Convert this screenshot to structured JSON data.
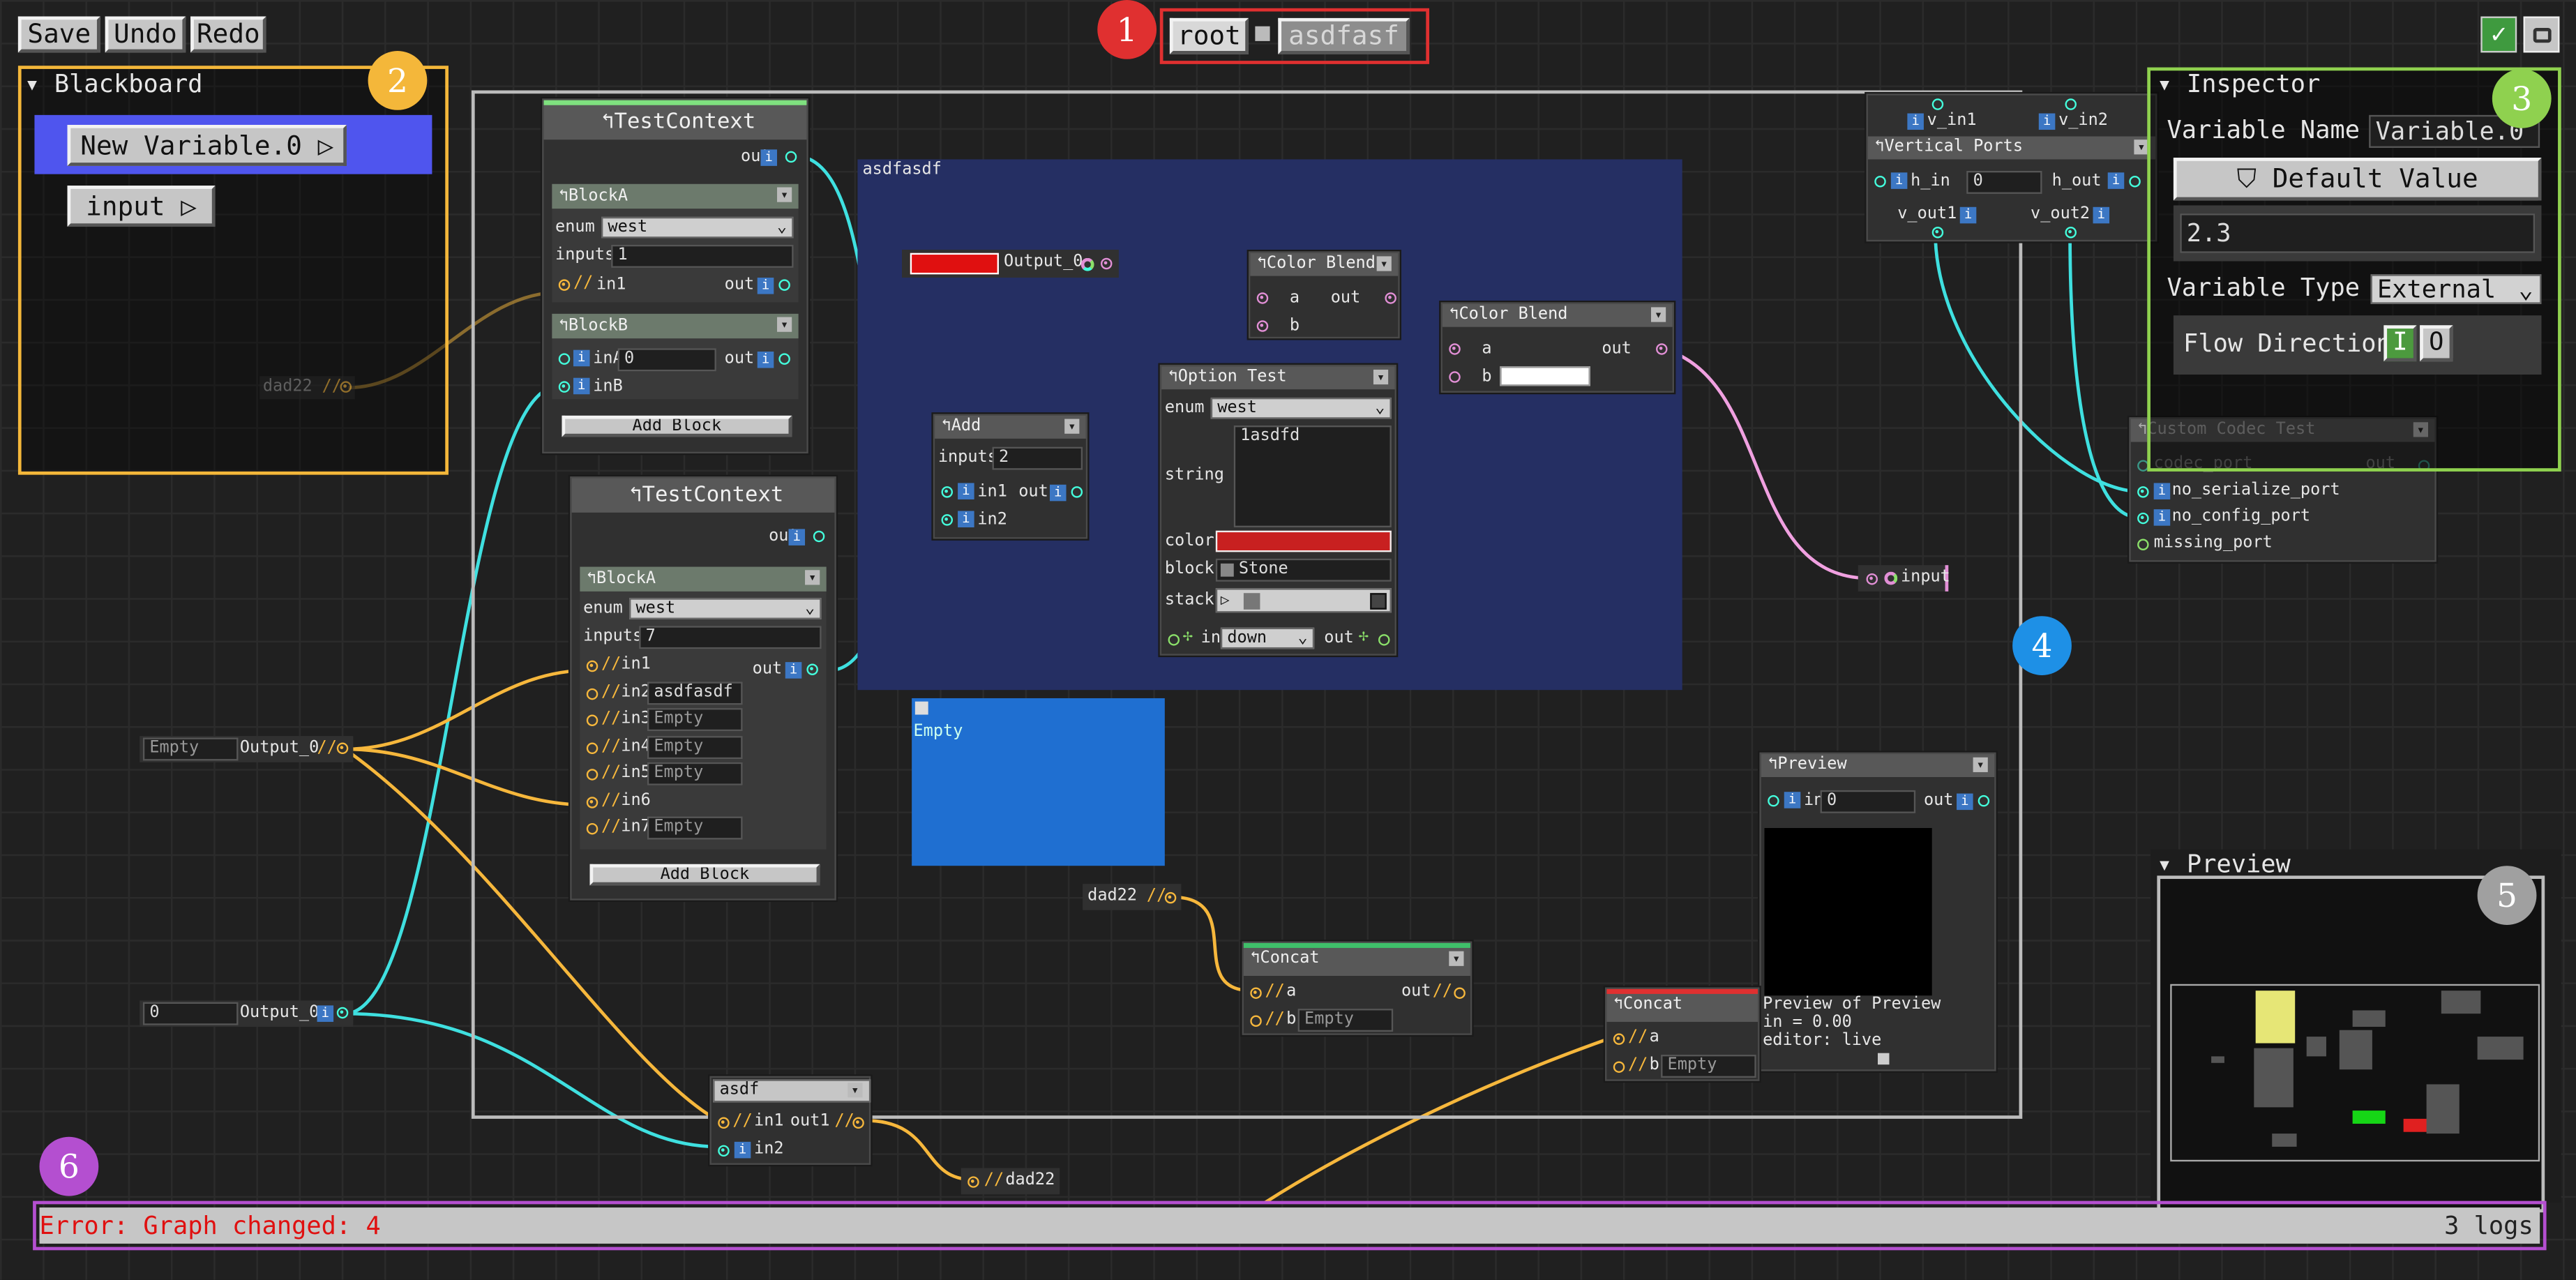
{
  "toolbar": {
    "save": "Save",
    "undo": "Undo",
    "redo": "Redo"
  },
  "breadcrumb": {
    "root": "root",
    "current": "asdfasf"
  },
  "badges": [
    "1",
    "2",
    "3",
    "4",
    "5",
    "6"
  ],
  "blackboard": {
    "title": "Blackboard",
    "items": [
      "New Variable.0",
      "input"
    ]
  },
  "inspector": {
    "title": "Inspector",
    "var_name_label": "Variable Name",
    "var_name_value": "Variable.0",
    "default_value_label": "Default Value",
    "default_value": "2.3",
    "var_type_label": "Variable Type",
    "var_type_value": "External",
    "flow_label": "Flow Direction",
    "flow_in": "I",
    "flow_out": "O"
  },
  "preview_panel": {
    "title": "Preview"
  },
  "status": {
    "error": "Error: Graph changed: 4",
    "logs": "3 logs"
  },
  "group": {
    "title": "asdfasdf"
  },
  "empty_note": "Empty",
  "nodes": {
    "tc1": {
      "title": "TestContext",
      "out": "out",
      "blockA": {
        "title": "BlockA",
        "enum_label": "enum",
        "enum_value": "west",
        "inputs_label": "inputs",
        "inputs_value": "1",
        "in1": "in1",
        "out": "out"
      },
      "blockB": {
        "title": "BlockB",
        "inA": "inA",
        "inA_value": "0",
        "inB": "inB",
        "out": "out"
      },
      "add_block": "Add Block"
    },
    "tc2": {
      "title": "TestContext",
      "out": "out",
      "blockA": {
        "title": "BlockA",
        "enum_label": "enum",
        "enum_value": "west",
        "inputs_label": "inputs",
        "inputs_value": "7",
        "out": "out",
        "ins": [
          {
            "label": "in1",
            "value": ""
          },
          {
            "label": "in2",
            "value": "asdfasdf"
          },
          {
            "label": "in3",
            "value": "Empty"
          },
          {
            "label": "in4",
            "value": "Empty"
          },
          {
            "label": "in5",
            "value": "Empty"
          },
          {
            "label": "in6",
            "value": ""
          },
          {
            "label": "in7",
            "value": "Empty"
          }
        ]
      },
      "add_block": "Add Block"
    },
    "dad22_a": {
      "label": "dad22"
    },
    "dad22_b": {
      "label": "dad22"
    },
    "dad22_c": {
      "label": "dad22"
    },
    "out_empty": {
      "value": "Empty",
      "label": "Output_0"
    },
    "out_zero": {
      "value": "0",
      "label": "Output_0"
    },
    "out_color": {
      "label": "Output_0",
      "color": "#e01010"
    },
    "add": {
      "title": "Add",
      "inputs_label": "inputs",
      "inputs_value": "2",
      "in1": "in1",
      "in2": "in2",
      "out": "out"
    },
    "blend1": {
      "title": "Color Blend",
      "a": "a",
      "b": "b",
      "out": "out"
    },
    "blend2": {
      "title": "Color Blend",
      "a": "a",
      "b": "b",
      "out": "out"
    },
    "option": {
      "title": "Option Test",
      "enum_label": "enum",
      "enum_value": "west",
      "string_label": "string",
      "string_value": "1asdfd",
      "color_label": "color",
      "color_value": "#c82020",
      "block_label": "block",
      "block_value": "Stone",
      "stack_label": "stack",
      "in_label": "in",
      "in_value": "down",
      "out": "out"
    },
    "vports": {
      "title": "Vertical Ports",
      "v_in1": "v_in1",
      "v_in2": "v_in2",
      "h_in": "h_in",
      "h_in_value": "0",
      "h_out": "h_out",
      "v_out1": "v_out1",
      "v_out2": "v_out2"
    },
    "codec": {
      "title": "Custom Codec Test",
      "codec_port": "codec_port",
      "out": "out",
      "ports": [
        "no_serialize_port",
        "no_config_port",
        "missing_port"
      ]
    },
    "input_ref": {
      "label": "input"
    },
    "preview": {
      "title": "Preview",
      "in": "in",
      "in_value": "0",
      "out": "out",
      "caption1": "Preview of Preview",
      "caption2": "in = 0.00",
      "caption3": "editor: live"
    },
    "concat1": {
      "title": "Concat",
      "a": "a",
      "b": "b",
      "b_value": "Empty",
      "out": "out",
      "bar_color": "#3fbf6a"
    },
    "concat2": {
      "title": "Concat",
      "a": "a",
      "b": "b",
      "b_value": "Empty",
      "bar_color": "#e03030"
    },
    "asdf": {
      "title": "asdf",
      "in1": "in1",
      "in2": "in2",
      "out1": "out1"
    }
  },
  "colors": {
    "badge1": "#e03030",
    "badge2": "#f4b73a",
    "badge3": "#8fd14f",
    "badge4": "#1e90e6",
    "badge5": "#a0a0a0",
    "badge6": "#b44fd0",
    "group_fill": "#252f63",
    "empty_box": "#1f6fd1"
  }
}
